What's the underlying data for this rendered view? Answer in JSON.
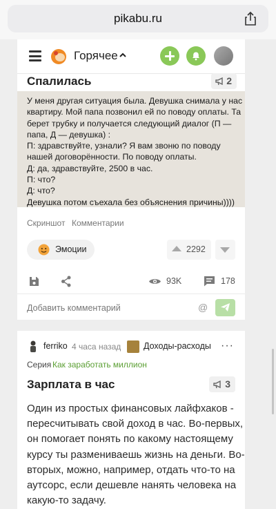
{
  "browser": {
    "url": "pikabu.ru"
  },
  "header": {
    "section_label": "Горячее"
  },
  "post1": {
    "title": "Спалилась",
    "badge_count": "2",
    "story_lines": [
      "У меня другая ситуация была. Девушка снимала у нас",
      "квартиру. Мой папа позвонил ей по поводу оплаты. Та",
      "берет трубку и получается следующий диалог (П —",
      "папа, Д — девушка) :",
      "П: здравствуйте, узнали? Я вам звоню по поводу",
      "нашей договорённости. По поводу оплаты.",
      "Д: да, здравствуйте, 2500 в час.",
      "П: что?",
      "Д: что?",
      "Девушка потом съехала без объяснения причины))))"
    ],
    "tags": [
      "Скриншот",
      "Комментарии"
    ],
    "emotions_label": "Эмоции",
    "rating": "2292",
    "views": "93K",
    "comments": "178",
    "comment_placeholder": "Добавить комментарий",
    "at_symbol": "@"
  },
  "post2": {
    "author": "ferriko",
    "time": "4 часа назад",
    "community": "Доходы-расходы",
    "more": "···",
    "series_label": "Серия",
    "series_name": "Как заработать миллион",
    "title": "Зарплата в час",
    "badge_count": "3",
    "body_lines": [
      "Один из простых финансовых лайфхаков -",
      "пересчитывать свой доход в час. Во-первых,",
      "он помогает понять по какому настоящему",
      "курсу ты размениваешь жизнь на деньги. Во-",
      "вторых, можно, например, отдать что-то на",
      "аутсорс, если дешевле нанять человека на",
      "какую-то задачу."
    ]
  },
  "colors": {
    "accent_green": "#8ac858",
    "story_bg": "#e7e3dc",
    "link_green": "#5a9e32"
  }
}
